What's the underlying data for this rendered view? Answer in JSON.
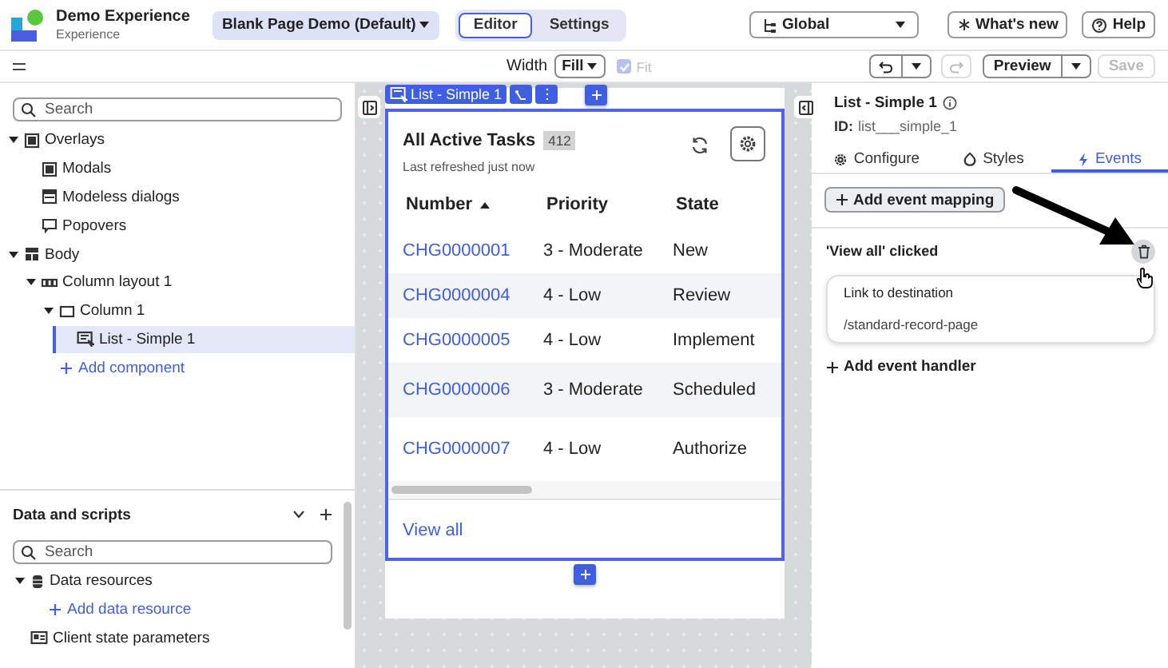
{
  "app": {
    "title": "Demo Experience",
    "subtitle": "Experience"
  },
  "page_selector": {
    "label": "Blank Page Demo (Default)"
  },
  "mode_tabs": [
    {
      "label": "Editor",
      "selected": true
    },
    {
      "label": "Settings",
      "selected": false
    }
  ],
  "scope_selector": {
    "label": "Global"
  },
  "header_buttons": [
    {
      "label": "What's new",
      "kind": "star"
    },
    {
      "label": "Help",
      "kind": "help"
    }
  ],
  "toolbar": {
    "width_label": "Width",
    "width_value": "Fill",
    "fit": {
      "label": "Fit",
      "checked": true,
      "disabled": true
    },
    "undo": {
      "disabled": false
    },
    "redo": {
      "disabled": true
    },
    "preview": "Preview",
    "save": {
      "label": "Save",
      "disabled": true
    }
  },
  "content_tree": {
    "search_placeholder": "Search",
    "items": [
      {
        "label": "Overlays",
        "kind": "overlay",
        "expanded": true,
        "children": [
          {
            "label": "Modals",
            "kind": "modal"
          },
          {
            "label": "Modeless dialogs",
            "kind": "modeless"
          },
          {
            "label": "Popovers",
            "kind": "popover"
          }
        ]
      },
      {
        "label": "Body",
        "kind": "body",
        "expanded": true,
        "children": [
          {
            "label": "Column layout 1",
            "kind": "columns",
            "expanded": true,
            "children": [
              {
                "label": "Column 1",
                "kind": "column",
                "expanded": true,
                "children": [
                  {
                    "label": "List - Simple 1",
                    "kind": "list",
                    "selected": true
                  }
                ]
              },
              {
                "label": "Add component",
                "kind": "add"
              }
            ]
          }
        ]
      }
    ]
  },
  "data_scripts": {
    "title": "Data and scripts",
    "search_placeholder": "Search",
    "items": [
      {
        "label": "Data resources",
        "kind": "database",
        "expanded": true,
        "children": [
          {
            "label": "Add data resource",
            "kind": "add"
          }
        ]
      },
      {
        "label": "Client state parameters",
        "kind": "params"
      }
    ]
  },
  "canvas": {
    "component_tag": "List - Simple 1",
    "list": {
      "title": "All Active Tasks",
      "count": "412",
      "subtitle": "Last refreshed just now",
      "columns": [
        {
          "label": "Number",
          "sorted": true
        },
        {
          "label": "Priority",
          "sorted": false
        },
        {
          "label": "State",
          "sorted": false
        }
      ],
      "rows": [
        [
          "CHG0000001",
          "3 - Moderate",
          "New"
        ],
        [
          "CHG0000004",
          "4 - Low",
          "Review"
        ],
        [
          "CHG0000005",
          "4 - Low",
          "Implement"
        ],
        [
          "CHG0000006",
          "3 - Moderate",
          "Scheduled"
        ],
        [
          "CHG0000007",
          "4 - Low",
          "Authorize"
        ]
      ],
      "footer_link": "View all"
    }
  },
  "inspector": {
    "title": "List - Simple 1",
    "id_label": "ID:",
    "id_value": "list___simple_1",
    "tabs": [
      {
        "label": "Configure",
        "kind": "gear",
        "selected": false
      },
      {
        "label": "Styles",
        "kind": "styles",
        "selected": false
      },
      {
        "label": "Events",
        "kind": "bolt",
        "selected": true
      }
    ],
    "add_event_mapping": "Add event mapping",
    "event": {
      "title": "'View all' clicked",
      "handlers": [
        {
          "title": "Link to destination",
          "detail": "/standard-record-page"
        }
      ],
      "add_handler": "Add event handler"
    }
  }
}
